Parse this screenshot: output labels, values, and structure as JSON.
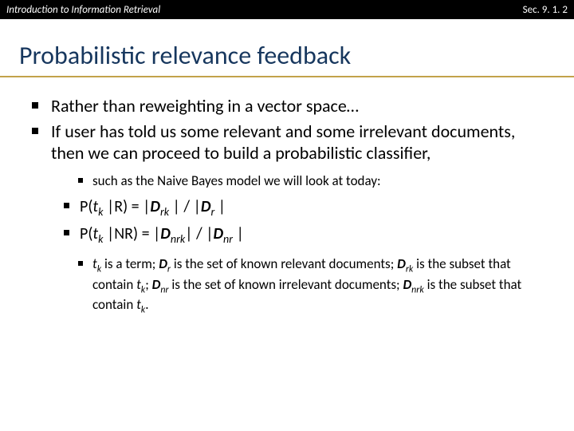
{
  "header": {
    "left": "Introduction to Information Retrieval",
    "right": "Sec. 9. 1. 2"
  },
  "title": "Probabilistic relevance feedback",
  "bullets": {
    "b1": "Rather than reweighting in a vector space…",
    "b2": "If user has told us some relevant and some irrelevant documents, then we can proceed to build a probabilistic classifier,",
    "b2_sub1": "such as the Naive Bayes model we will look at today:",
    "formula1_prefix": "P(",
    "formula1_tk_t": "t",
    "formula1_tk_k": "k",
    "formula1_mid": " |R) = |",
    "formula1_Drk_D": "D",
    "formula1_Drk_rk": "rk",
    "formula1_mid2": " | / |",
    "formula1_Dr_D": "D",
    "formula1_Dr_r": "r",
    "formula1_end": " |",
    "formula2_prefix": "P(",
    "formula2_tk_t": "t",
    "formula2_tk_k": "k",
    "formula2_mid": " |NR) = |",
    "formula2_Dnrk_D": "D",
    "formula2_Dnrk_nrk": "nrk",
    "formula2_mid2": "| / |",
    "formula2_Dnr_D": "D",
    "formula2_Dnr_nr": "nr",
    "formula2_end": " |",
    "defs_p1_t": "t",
    "defs_p1_k": "k",
    "defs_p1_rest": " is a term; ",
    "defs_p2_D": "D",
    "defs_p2_r": "r",
    "defs_p2_rest": " is the set of known relevant documents; ",
    "defs_p3_D": "D",
    "defs_p3_rk": "rk",
    "defs_p3_rest": " is the subset that contain ",
    "defs_p4_t": "t",
    "defs_p4_k": "k",
    "defs_p4_rest": "; ",
    "defs_p5_D": "D",
    "defs_p5_nr": "nr",
    "defs_p5_rest": " is the set of known irrelevant documents; ",
    "defs_p6_D": "D",
    "defs_p6_nrk": "nrk",
    "defs_p6_rest": " is the subset that contain ",
    "defs_p7_t": "t",
    "defs_p7_k": "k",
    "defs_p7_rest": "."
  }
}
